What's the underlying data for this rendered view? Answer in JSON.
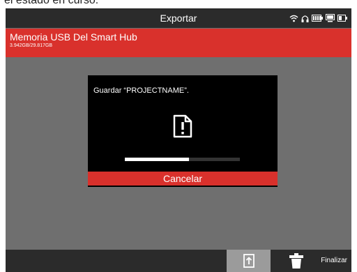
{
  "caption_fragment": "el estado en curso.",
  "statusbar": {
    "title": "Exportar",
    "icons": [
      "wifi-icon",
      "headphones-icon",
      "battery-icon",
      "storage-icon",
      "media-icon"
    ]
  },
  "header": {
    "destination": "Memoria USB Del Smart Hub",
    "usage": "3.942GB/29.817GB",
    "accent_color": "#d9312c"
  },
  "dialog": {
    "message": "Guardar “PROJECTNAME”.",
    "icon": "file-warning-icon",
    "progress": 0.56,
    "cancel_label": "Cancelar"
  },
  "bottombar": {
    "export_icon": "export-icon",
    "delete_icon": "trash-icon",
    "finish_label": "Finalizar"
  }
}
